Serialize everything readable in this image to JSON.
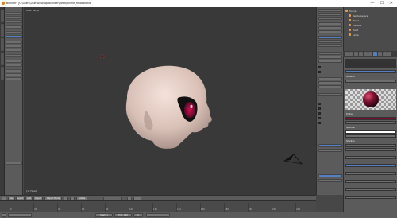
{
  "window": {
    "title": "Blender* [C:\\Users\\User\\Desktop\\Blender\\Head\\Anime_Head.blend]",
    "minimize": "—",
    "maximize": "☐",
    "close": "✕"
  },
  "viewport": {
    "view_label": "User Persp",
    "object_label": "(1) Head"
  },
  "header": {
    "view": "View",
    "select": "Select",
    "add": "Add",
    "object": "Object",
    "mode": "Object Mode",
    "layers": "Global"
  },
  "timeline": {
    "numbers": [
      "0",
      "20",
      "40",
      "60",
      "80",
      "100",
      "120",
      "140",
      "160",
      "180",
      "200",
      "220",
      "240"
    ],
    "start_label": "Start: 1",
    "end_label": "End: 250",
    "current_label": "1"
  },
  "outliner": {
    "items": [
      "Scene",
      "RenderLayers",
      "World",
      "Camera",
      "Head",
      "Lamp"
    ]
  },
  "properties": {
    "material_name": "Material",
    "diffuse_label": "Diffuse",
    "specular_label": "Specular",
    "shading_label": "Shading"
  },
  "colors": {
    "accent": "#5680c2",
    "material_color": "#7a1030"
  },
  "icons": {
    "head_mesh": "3d-head-model",
    "camera": "camera-object-icon",
    "cursor": "3d-cursor-icon"
  }
}
